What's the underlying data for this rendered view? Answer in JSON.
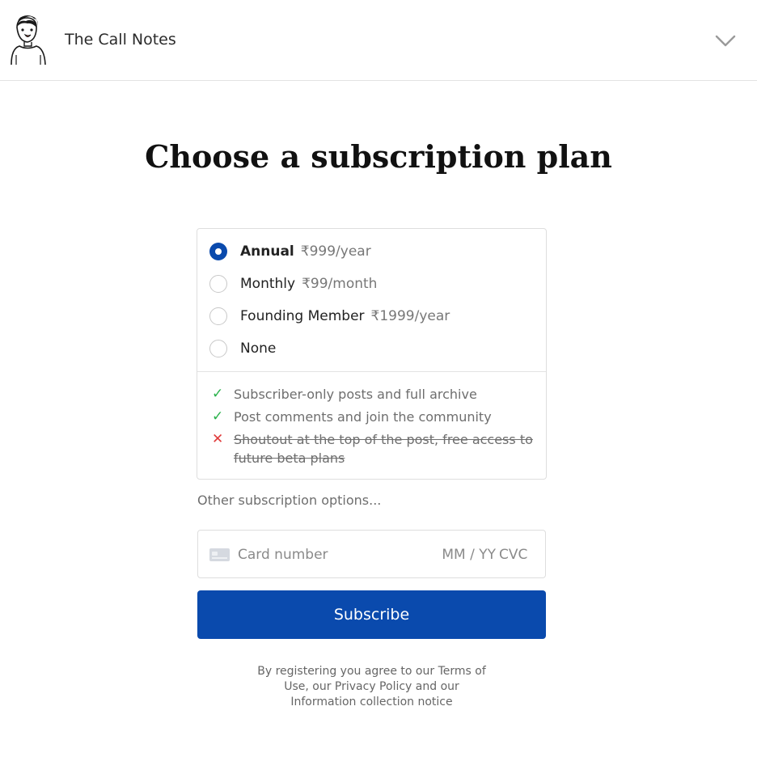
{
  "header": {
    "publication_name": "The Call Notes",
    "avatar_icon": "cartoon-avatar",
    "menu_icon": "chevron-down-icon"
  },
  "title": "Choose a subscription plan",
  "plans": [
    {
      "name": "Annual",
      "price": "₹999/year",
      "selected": true
    },
    {
      "name": "Monthly",
      "price": "₹99/month",
      "selected": false
    },
    {
      "name": "Founding Member",
      "price": "₹1999/year",
      "selected": false
    },
    {
      "name": "None",
      "price": "",
      "selected": false
    }
  ],
  "features": [
    {
      "text": "Subscriber-only posts and full archive",
      "included": true
    },
    {
      "text": "Post comments and join the community",
      "included": true
    },
    {
      "text": "Shoutout at the top of the post, free access to future beta plans",
      "included": false
    }
  ],
  "other_options_link": "Other subscription options...",
  "card": {
    "number_placeholder": "Card number",
    "expiry_placeholder": "MM / YY",
    "cvc_placeholder": "CVC"
  },
  "subscribe_label": "Subscribe",
  "legal_text": "By registering you agree to our Terms of Use, our Privacy Policy and our Information collection notice",
  "colors": {
    "accent": "#0a4aad",
    "check": "#2bb24c",
    "cross": "#e03a3a"
  }
}
